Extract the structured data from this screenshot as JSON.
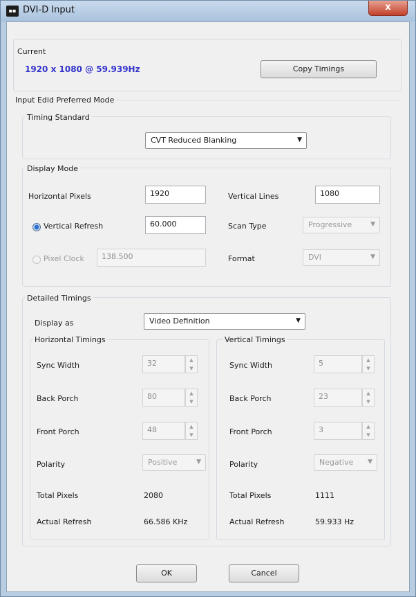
{
  "window": {
    "title": "DVI-D Input",
    "close": "x"
  },
  "current": {
    "group_label": "Current",
    "value": "1920 x 1080 @ 59.939Hz",
    "copy_button": "Copy Timings"
  },
  "edid": {
    "section_label": "Input Edid Preferred Mode",
    "timing_standard": {
      "group_label": "Timing Standard",
      "selected": "CVT Reduced Blanking"
    },
    "display_mode": {
      "group_label": "Display Mode",
      "horizontal_pixels_label": "Horizontal Pixels",
      "horizontal_pixels_value": "1920",
      "vertical_lines_label": "Vertical Lines",
      "vertical_lines_value": "1080",
      "vertical_refresh_label": "Vertical Refresh",
      "vertical_refresh_value": "60.000",
      "scan_type_label": "Scan Type",
      "scan_type_value": "Progressive",
      "pixel_clock_label": "Pixel Clock",
      "pixel_clock_value": "138.500",
      "format_label": "Format",
      "format_value": "DVI"
    },
    "detailed": {
      "group_label": "Detailed Timings",
      "display_as_label": "Display as",
      "display_as_value": "Video Definition",
      "horizontal": {
        "label": "Horizontal Timings",
        "sync_width_label": "Sync Width",
        "sync_width_value": "32",
        "back_porch_label": "Back Porch",
        "back_porch_value": "80",
        "front_porch_label": "Front Porch",
        "front_porch_value": "48",
        "polarity_label": "Polarity",
        "polarity_value": "Positive",
        "total_label": "Total Pixels",
        "total_value": "2080",
        "refresh_label": "Actual Refresh",
        "refresh_value": "66.586 KHz"
      },
      "vertical": {
        "label": "Vertical Timings",
        "sync_width_label": "Sync Width",
        "sync_width_value": "5",
        "back_porch_label": "Back Porch",
        "back_porch_value": "23",
        "front_porch_label": "Front Porch",
        "front_porch_value": "3",
        "polarity_label": "Polarity",
        "polarity_value": "Negative",
        "total_label": "Total Pixels",
        "total_value": "1111",
        "refresh_label": "Actual Refresh",
        "refresh_value": "59.933 Hz"
      }
    }
  },
  "buttons": {
    "ok": "OK",
    "cancel": "Cancel"
  }
}
